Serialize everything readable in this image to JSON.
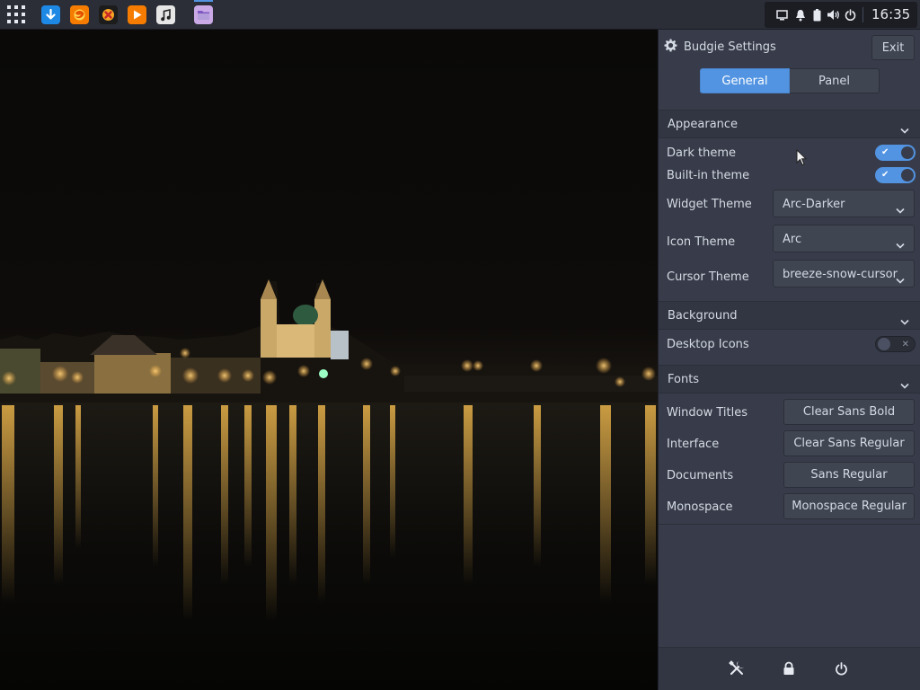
{
  "top_panel": {
    "launchers": [
      {
        "name": "downloader-icon",
        "color": "#1e88e5"
      },
      {
        "name": "firefox-icon",
        "color": "#f57c00"
      },
      {
        "name": "xfce-app-icon",
        "color": "#f5a623"
      },
      {
        "name": "media-player-icon",
        "color": "#f57c00"
      },
      {
        "name": "music-icon",
        "color": "#e6e6e6"
      },
      {
        "name": "file-manager-icon",
        "color": "#c9a9e6"
      }
    ],
    "tray_icons": [
      "display-icon",
      "notification-bell-icon",
      "battery-icon",
      "volume-icon",
      "power-icon"
    ],
    "clock": "16:35"
  },
  "settings": {
    "title": "Budgie Settings",
    "exit_label": "Exit",
    "tabs": [
      {
        "label": "General",
        "active": true
      },
      {
        "label": "Panel",
        "active": false
      }
    ],
    "appearance": {
      "header": "Appearance",
      "dark_theme_label": "Dark theme",
      "dark_theme_on": true,
      "builtin_theme_label": "Built-in theme",
      "builtin_theme_on": true,
      "widget_theme_label": "Widget Theme",
      "widget_theme_value": "Arc-Darker",
      "icon_theme_label": "Icon Theme",
      "icon_theme_value": "Arc",
      "cursor_theme_label": "Cursor Theme",
      "cursor_theme_value": "breeze-snow-cursor"
    },
    "background": {
      "header": "Background",
      "desktop_icons_label": "Desktop Icons",
      "desktop_icons_on": false
    },
    "fonts": {
      "header": "Fonts",
      "window_titles_label": "Window Titles",
      "window_titles_value": "Clear Sans Bold",
      "interface_label": "Interface",
      "interface_value": "Clear Sans Regular",
      "documents_label": "Documents",
      "documents_value": "Sans Regular",
      "monospace_label": "Monospace",
      "monospace_value": "Monospace Regular"
    },
    "footer_icons": [
      "settings-tools-icon",
      "lock-icon",
      "power-icon"
    ]
  },
  "colors": {
    "accent": "#5294e2",
    "panel_bg": "#383c4a",
    "topbar_bg": "#2b2e37"
  }
}
